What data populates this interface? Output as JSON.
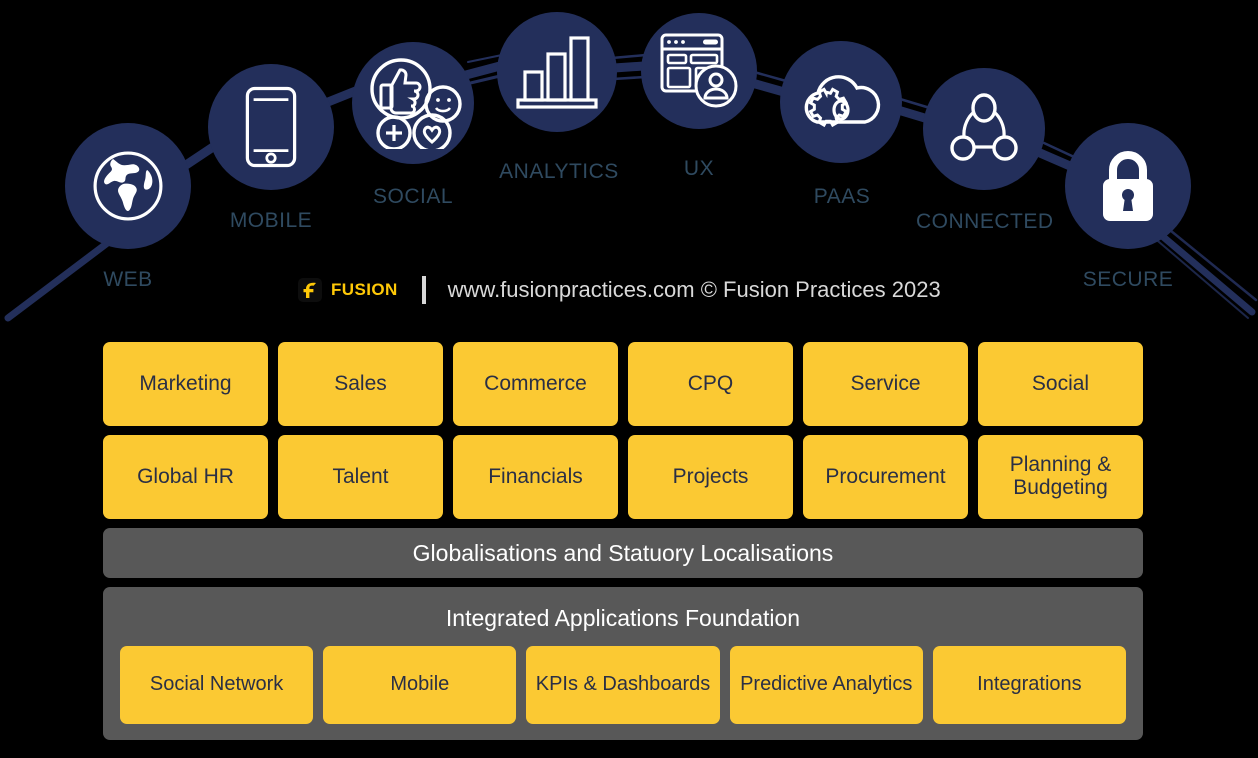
{
  "arc": {
    "nodes": [
      {
        "id": "web",
        "label": "WEB",
        "icon": "globe-icon"
      },
      {
        "id": "mobile",
        "label": "MOBILE",
        "icon": "smartphone-icon"
      },
      {
        "id": "social",
        "label": "SOCIAL",
        "icon": "thumbs-up-social-icon"
      },
      {
        "id": "analytics",
        "label": "ANALYTICS",
        "icon": "bar-chart-icon"
      },
      {
        "id": "ux",
        "label": "UX",
        "icon": "browser-user-icon"
      },
      {
        "id": "paas",
        "label": "PAAS",
        "icon": "cloud-gear-icon"
      },
      {
        "id": "connected",
        "label": "CONNECTED",
        "icon": "network-nodes-icon"
      },
      {
        "id": "secure",
        "label": "SECURE",
        "icon": "padlock-icon"
      }
    ]
  },
  "brand": {
    "mark_icon": "fusion-f-logo-icon",
    "name": "FUSION",
    "copyright": "www.fusionpractices.com © Fusion Practices 2023"
  },
  "stack": {
    "row1": [
      "Marketing",
      "Sales",
      "Commerce",
      "CPQ",
      "Service",
      "Social"
    ],
    "row2": [
      "Global HR",
      "Talent",
      "Financials",
      "Projects",
      "Procurement",
      "Planning & Budgeting"
    ],
    "globalisations_band": "Globalisations and Statuory Localisations",
    "foundation": {
      "title": "Integrated Applications Foundation",
      "tiles": [
        "Social Network",
        "Mobile",
        "KPIs & Dashboards",
        "Predictive Analytics",
        "Integrations"
      ]
    }
  },
  "colors": {
    "background": "#000000",
    "node_navy": "#232F5B",
    "tile_yellow": "#FBC933",
    "band_gray": "#585858",
    "label_blue_gray": "#2F4A60",
    "brand_yellow": "#FFC907",
    "tile_text": "#2A2F45"
  }
}
